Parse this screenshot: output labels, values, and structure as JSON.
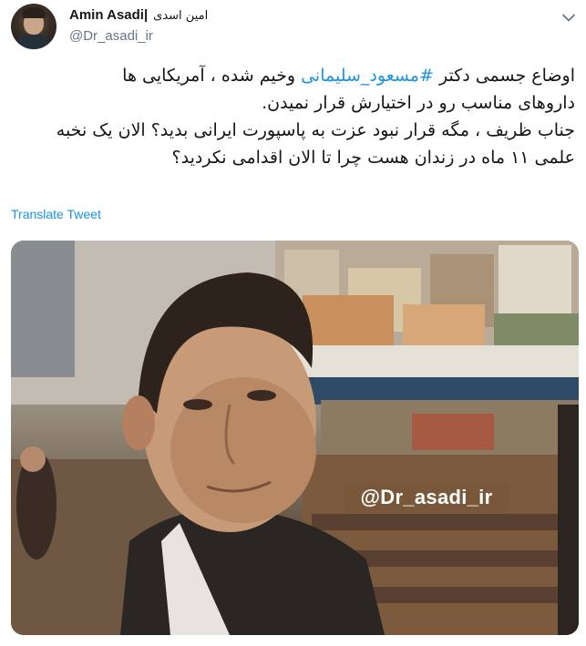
{
  "author": {
    "display_name": "Amin Asadi|",
    "display_name_fa": "امین اسدی",
    "handle": "@Dr_asadi_ir"
  },
  "tweet": {
    "line1_before": "اوضاع جسمی دکتر ",
    "hashtag": "#مسعود_سلیمانی",
    "line1_after": " وخیم شده ، آمریکایی ها",
    "line2": "داروهای مناسب رو در اختیارش قرار نمیدن.",
    "line3": "جناب ظریف ، مگه قرار نبود عزت به پاسپورت ایرانی بدید؟ الان یک نخبه",
    "line4": "علمی ۱۱ ماه در زندان هست چرا تا الان اقدامی نکردید؟"
  },
  "actions": {
    "translate_label": "Translate Tweet"
  },
  "media": {
    "watermark": "@Dr_asadi_ir"
  },
  "icons": {
    "more": "chevron-down-icon"
  },
  "colors": {
    "link": "#1b95e0",
    "secondary_text": "#657786",
    "primary_text": "#14171a"
  }
}
